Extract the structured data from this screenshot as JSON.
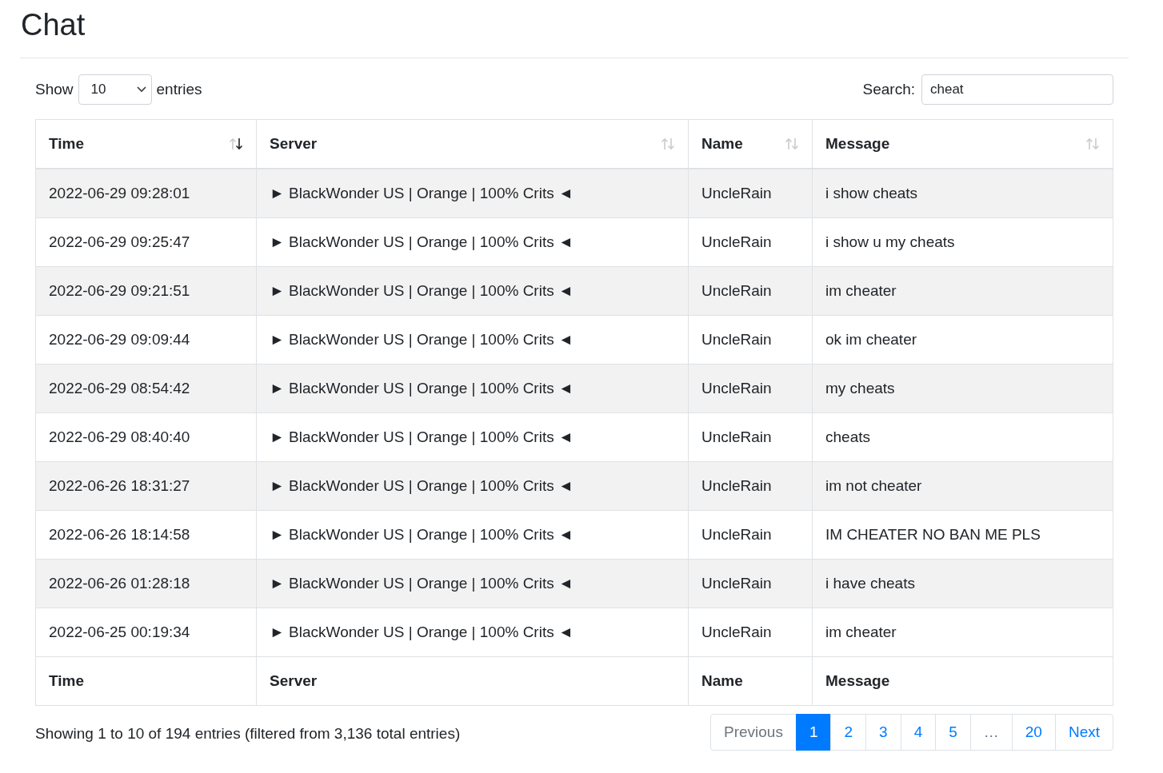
{
  "title": "Chat",
  "length": {
    "label_before": "Show",
    "value": "10",
    "label_after": "entries"
  },
  "search": {
    "label": "Search:",
    "value": "cheat"
  },
  "table": {
    "columns": [
      {
        "label": "Time",
        "sorted": true
      },
      {
        "label": "Server",
        "sorted": false
      },
      {
        "label": "Name",
        "sorted": false
      },
      {
        "label": "Message",
        "sorted": false
      }
    ],
    "rows": [
      [
        "2022-06-29 09:28:01",
        "► BlackWonder US | Orange | 100% Crits ◄",
        "UncleRain",
        "i show cheats"
      ],
      [
        "2022-06-29 09:25:47",
        "► BlackWonder US | Orange | 100% Crits ◄",
        "UncleRain",
        "i show u my cheats"
      ],
      [
        "2022-06-29 09:21:51",
        "► BlackWonder US | Orange | 100% Crits ◄",
        "UncleRain",
        "im cheater"
      ],
      [
        "2022-06-29 09:09:44",
        "► BlackWonder US | Orange | 100% Crits ◄",
        "UncleRain",
        "ok im cheater"
      ],
      [
        "2022-06-29 08:54:42",
        "► BlackWonder US | Orange | 100% Crits ◄",
        "UncleRain",
        "my cheats"
      ],
      [
        "2022-06-29 08:40:40",
        "► BlackWonder US | Orange | 100% Crits ◄",
        "UncleRain",
        "cheats"
      ],
      [
        "2022-06-26 18:31:27",
        "► BlackWonder US | Orange | 100% Crits ◄",
        "UncleRain",
        "im not cheater"
      ],
      [
        "2022-06-26 18:14:58",
        "► BlackWonder US | Orange | 100% Crits ◄",
        "UncleRain",
        "IM CHEATER NO BAN ME PLS"
      ],
      [
        "2022-06-26 01:28:18",
        "► BlackWonder US | Orange | 100% Crits ◄",
        "UncleRain",
        "i have cheats"
      ],
      [
        "2022-06-25 00:19:34",
        "► BlackWonder US | Orange | 100% Crits ◄",
        "UncleRain",
        "im cheater"
      ]
    ],
    "footer": [
      "Time",
      "Server",
      "Name",
      "Message"
    ]
  },
  "info": "Showing 1 to 10 of 194 entries (filtered from 3,136 total entries)",
  "pagination": [
    {
      "label": "Previous",
      "selected": false,
      "disabled": true
    },
    {
      "label": "1",
      "selected": true,
      "disabled": false
    },
    {
      "label": "2",
      "selected": false,
      "disabled": false
    },
    {
      "label": "3",
      "selected": false,
      "disabled": false
    },
    {
      "label": "4",
      "selected": false,
      "disabled": false
    },
    {
      "label": "5",
      "selected": false,
      "disabled": false
    },
    {
      "label": "…",
      "selected": false,
      "disabled": true
    },
    {
      "label": "20",
      "selected": false,
      "disabled": false
    },
    {
      "label": "Next",
      "selected": false,
      "disabled": false
    }
  ]
}
